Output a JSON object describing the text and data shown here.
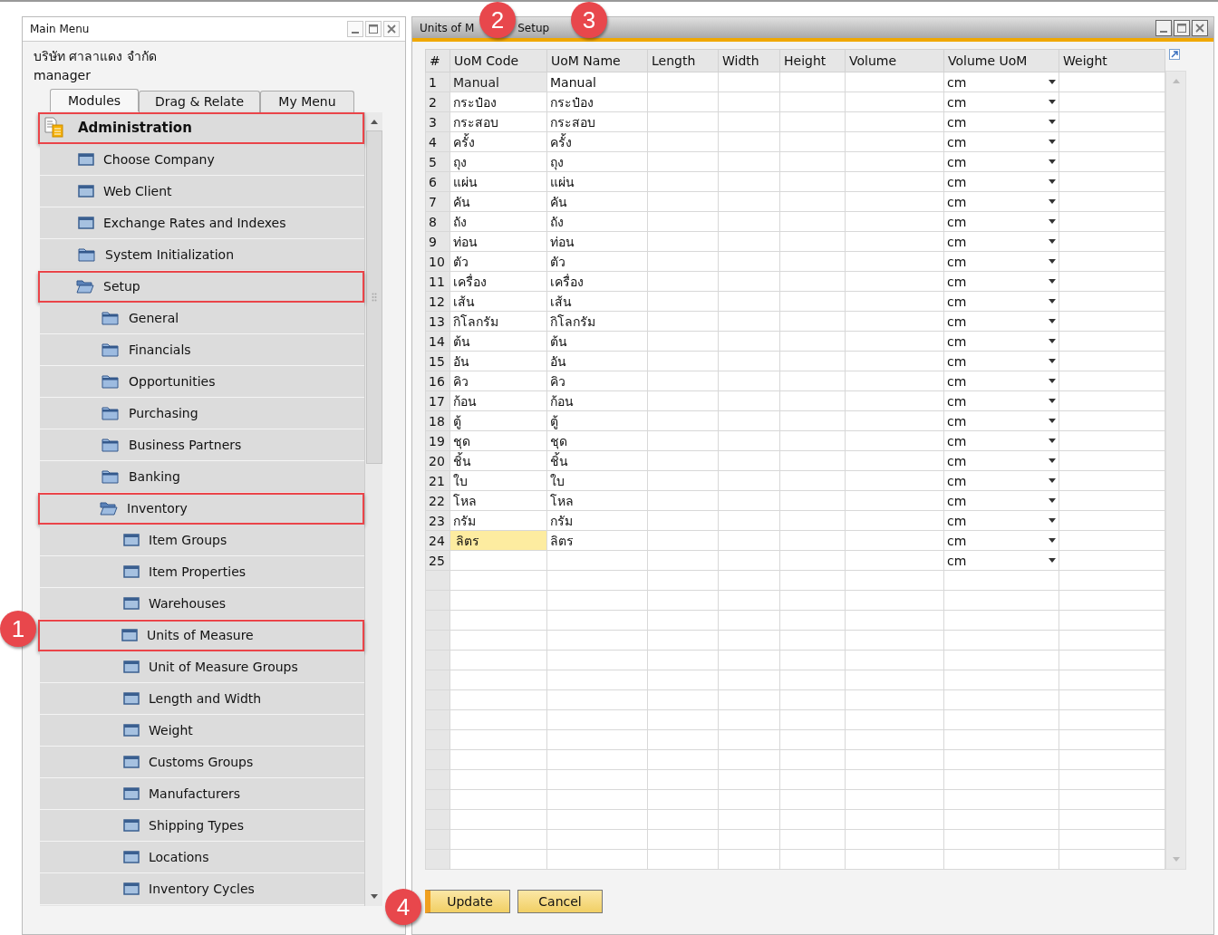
{
  "main_menu": {
    "title": "Main Menu",
    "company": "บริษัท ศาลาแดง จำกัด",
    "user": "manager",
    "tabs": [
      {
        "label": "Modules",
        "selected": true
      },
      {
        "label": "Drag & Relate",
        "selected": false
      },
      {
        "label": "My Menu",
        "selected": false
      }
    ],
    "tree": [
      {
        "label": "Administration",
        "kind": "module",
        "highlighted": true,
        "children": [
          {
            "label": "Choose Company",
            "kind": "form",
            "highlighted": false
          },
          {
            "label": "Web Client",
            "kind": "form",
            "highlighted": false
          },
          {
            "label": "Exchange Rates and Indexes",
            "kind": "form",
            "highlighted": false
          },
          {
            "label": "System Initialization",
            "kind": "folder",
            "expanded": false,
            "highlighted": false
          },
          {
            "label": "Setup",
            "kind": "folder",
            "expanded": true,
            "highlighted": true,
            "children": [
              {
                "label": "General",
                "kind": "folder",
                "expanded": false,
                "highlighted": false
              },
              {
                "label": "Financials",
                "kind": "folder",
                "expanded": false,
                "highlighted": false
              },
              {
                "label": "Opportunities",
                "kind": "folder",
                "expanded": false,
                "highlighted": false
              },
              {
                "label": "Purchasing",
                "kind": "folder",
                "expanded": false,
                "highlighted": false
              },
              {
                "label": "Business Partners",
                "kind": "folder",
                "expanded": false,
                "highlighted": false
              },
              {
                "label": "Banking",
                "kind": "folder",
                "expanded": false,
                "highlighted": false
              },
              {
                "label": "Inventory",
                "kind": "folder",
                "expanded": true,
                "highlighted": true,
                "children": [
                  {
                    "label": "Item Groups",
                    "kind": "form",
                    "highlighted": false
                  },
                  {
                    "label": "Item Properties",
                    "kind": "form",
                    "highlighted": false
                  },
                  {
                    "label": "Warehouses",
                    "kind": "form",
                    "highlighted": false
                  },
                  {
                    "label": "Units of Measure",
                    "kind": "form",
                    "highlighted": true
                  },
                  {
                    "label": "Unit of Measure Groups",
                    "kind": "form",
                    "highlighted": false
                  },
                  {
                    "label": "Length and Width",
                    "kind": "form",
                    "highlighted": false
                  },
                  {
                    "label": "Weight",
                    "kind": "form",
                    "highlighted": false
                  },
                  {
                    "label": "Customs Groups",
                    "kind": "form",
                    "highlighted": false
                  },
                  {
                    "label": "Manufacturers",
                    "kind": "form",
                    "highlighted": false
                  },
                  {
                    "label": "Shipping Types",
                    "kind": "form",
                    "highlighted": false
                  },
                  {
                    "label": "Locations",
                    "kind": "form",
                    "highlighted": false
                  },
                  {
                    "label": "Inventory Cycles",
                    "kind": "form",
                    "highlighted": false
                  }
                ]
              }
            ]
          }
        ]
      }
    ]
  },
  "uom_window": {
    "title_start": "Units of M",
    "title_end": "Setup",
    "table": {
      "columns": [
        "#",
        "UoM Code",
        "UoM Name",
        "Length",
        "Width",
        "Height",
        "Volume",
        "Volume UoM",
        "Weight"
      ],
      "rows": [
        {
          "number": "1",
          "code": "Manual",
          "name": "Manual",
          "volume_uom": "cm",
          "code_disabled": true,
          "focused": false
        },
        {
          "number": "2",
          "code": "กระป๋อง",
          "name": "กระป๋อง",
          "volume_uom": "cm",
          "code_disabled": false,
          "focused": false
        },
        {
          "number": "3",
          "code": "กระสอบ",
          "name": "กระสอบ",
          "volume_uom": "cm",
          "code_disabled": false,
          "focused": false
        },
        {
          "number": "4",
          "code": "ครั้ง",
          "name": "ครั้ง",
          "volume_uom": "cm",
          "code_disabled": false,
          "focused": false
        },
        {
          "number": "5",
          "code": "ถุง",
          "name": "ถุง",
          "volume_uom": "cm",
          "code_disabled": false,
          "focused": false
        },
        {
          "number": "6",
          "code": "แผ่น",
          "name": "แผ่น",
          "volume_uom": "cm",
          "code_disabled": false,
          "focused": false
        },
        {
          "number": "7",
          "code": "คัน",
          "name": "คัน",
          "volume_uom": "cm",
          "code_disabled": false,
          "focused": false
        },
        {
          "number": "8",
          "code": "ถัง",
          "name": "ถัง",
          "volume_uom": "cm",
          "code_disabled": false,
          "focused": false
        },
        {
          "number": "9",
          "code": "ท่อน",
          "name": "ท่อน",
          "volume_uom": "cm",
          "code_disabled": false,
          "focused": false
        },
        {
          "number": "10",
          "code": "ตัว",
          "name": "ตัว",
          "volume_uom": "cm",
          "code_disabled": false,
          "focused": false
        },
        {
          "number": "11",
          "code": "เครื่อง",
          "name": "เครื่อง",
          "volume_uom": "cm",
          "code_disabled": false,
          "focused": false
        },
        {
          "number": "12",
          "code": "เส้น",
          "name": "เส้น",
          "volume_uom": "cm",
          "code_disabled": false,
          "focused": false
        },
        {
          "number": "13",
          "code": "กิโลกรัม",
          "name": "กิโลกรัม",
          "volume_uom": "cm",
          "code_disabled": false,
          "focused": false
        },
        {
          "number": "14",
          "code": "ต้น",
          "name": "ต้น",
          "volume_uom": "cm",
          "code_disabled": false,
          "focused": false
        },
        {
          "number": "15",
          "code": "อัน",
          "name": "อัน",
          "volume_uom": "cm",
          "code_disabled": false,
          "focused": false
        },
        {
          "number": "16",
          "code": "คิว",
          "name": "คิว",
          "volume_uom": "cm",
          "code_disabled": false,
          "focused": false
        },
        {
          "number": "17",
          "code": "ก้อน",
          "name": "ก้อน",
          "volume_uom": "cm",
          "code_disabled": false,
          "focused": false
        },
        {
          "number": "18",
          "code": "ตู้",
          "name": "ตู้",
          "volume_uom": "cm",
          "code_disabled": false,
          "focused": false
        },
        {
          "number": "19",
          "code": "ชุด",
          "name": "ชุด",
          "volume_uom": "cm",
          "code_disabled": false,
          "focused": false
        },
        {
          "number": "20",
          "code": "ชิ้น",
          "name": "ชิ้น",
          "volume_uom": "cm",
          "code_disabled": false,
          "focused": false
        },
        {
          "number": "21",
          "code": "ใบ",
          "name": "ใบ",
          "volume_uom": "cm",
          "code_disabled": false,
          "focused": false
        },
        {
          "number": "22",
          "code": "โหล",
          "name": "โหล",
          "volume_uom": "cm",
          "code_disabled": false,
          "focused": false
        },
        {
          "number": "23",
          "code": "กรัม",
          "name": "กรัม",
          "volume_uom": "cm",
          "code_disabled": false,
          "focused": false
        },
        {
          "number": "24",
          "code": "ลิตร",
          "name": "ลิตร",
          "volume_uom": "cm",
          "code_disabled": false,
          "focused": true
        },
        {
          "number": "25",
          "volume_uom": "cm",
          "code_disabled": false,
          "focused": false
        }
      ]
    },
    "buttons": [
      "Update",
      "Cancel"
    ]
  },
  "callouts": [
    {
      "label": "1"
    },
    {
      "label": "2"
    },
    {
      "label": "3"
    },
    {
      "label": "4"
    }
  ]
}
